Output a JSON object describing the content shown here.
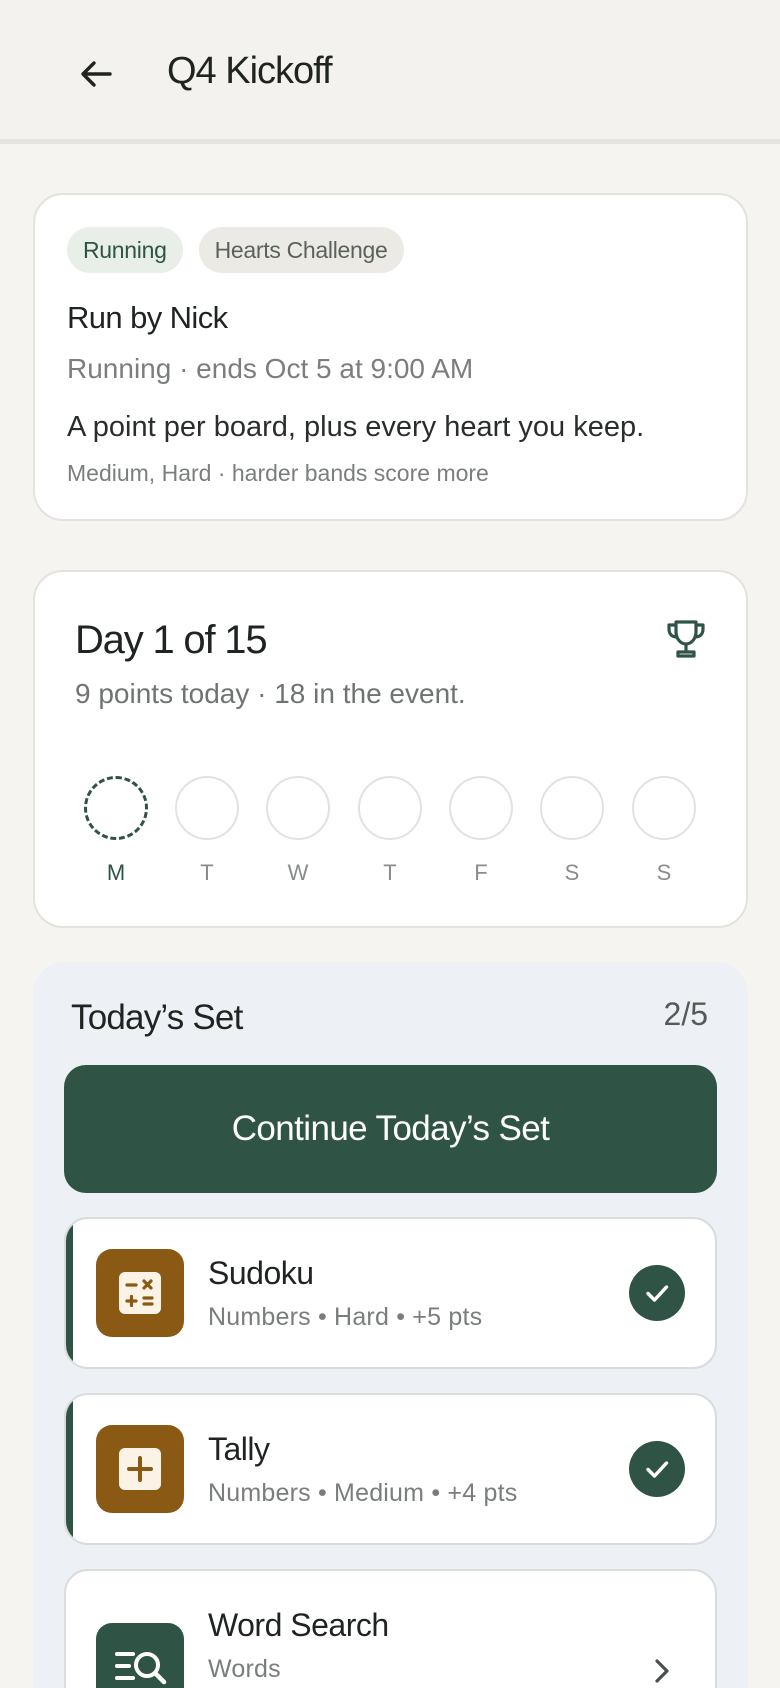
{
  "header": {
    "title": "Q4 Kickoff",
    "back_icon": "arrow-left-icon"
  },
  "event": {
    "status_chip": "Running",
    "type_chip": "Hearts Challenge",
    "run_by": "Run by Nick",
    "status_line": "Running · ends Oct 5 at 9:00 AM",
    "description": "A point per board, plus every heart you keep.",
    "note": "Medium, Hard · harder bands score more"
  },
  "progress": {
    "title": "Day 1 of 15",
    "subtitle": "9 points today · 18 in the event.",
    "trophy_icon": "trophy-icon",
    "days": [
      {
        "letter": "M",
        "today": true
      },
      {
        "letter": "T",
        "today": false
      },
      {
        "letter": "W",
        "today": false
      },
      {
        "letter": "T",
        "today": false
      },
      {
        "letter": "F",
        "today": false
      },
      {
        "letter": "S",
        "today": false
      },
      {
        "letter": "S",
        "today": false
      }
    ]
  },
  "todays_set": {
    "title": "Today’s Set",
    "count": "2/5",
    "continue_label": "Continue Today’s Set",
    "games": [
      {
        "name": "Sudoku",
        "meta": "Numbers • Hard • +5 pts",
        "done": true,
        "icon": "sudoku-icon",
        "icon_color": "#8a5a14"
      },
      {
        "name": "Tally",
        "meta": "Numbers • Medium • +4 pts",
        "done": true,
        "icon": "plus-icon",
        "icon_color": "#8a5a14"
      },
      {
        "name": "Word Search",
        "meta": "Words",
        "done": false,
        "icon": "word-search-icon",
        "icon_color": "#2f5446"
      }
    ]
  },
  "colors": {
    "accent": "#2f5446",
    "brown": "#8a5a14",
    "background": "#f5f4f0",
    "set_panel": "#edf1f6"
  }
}
